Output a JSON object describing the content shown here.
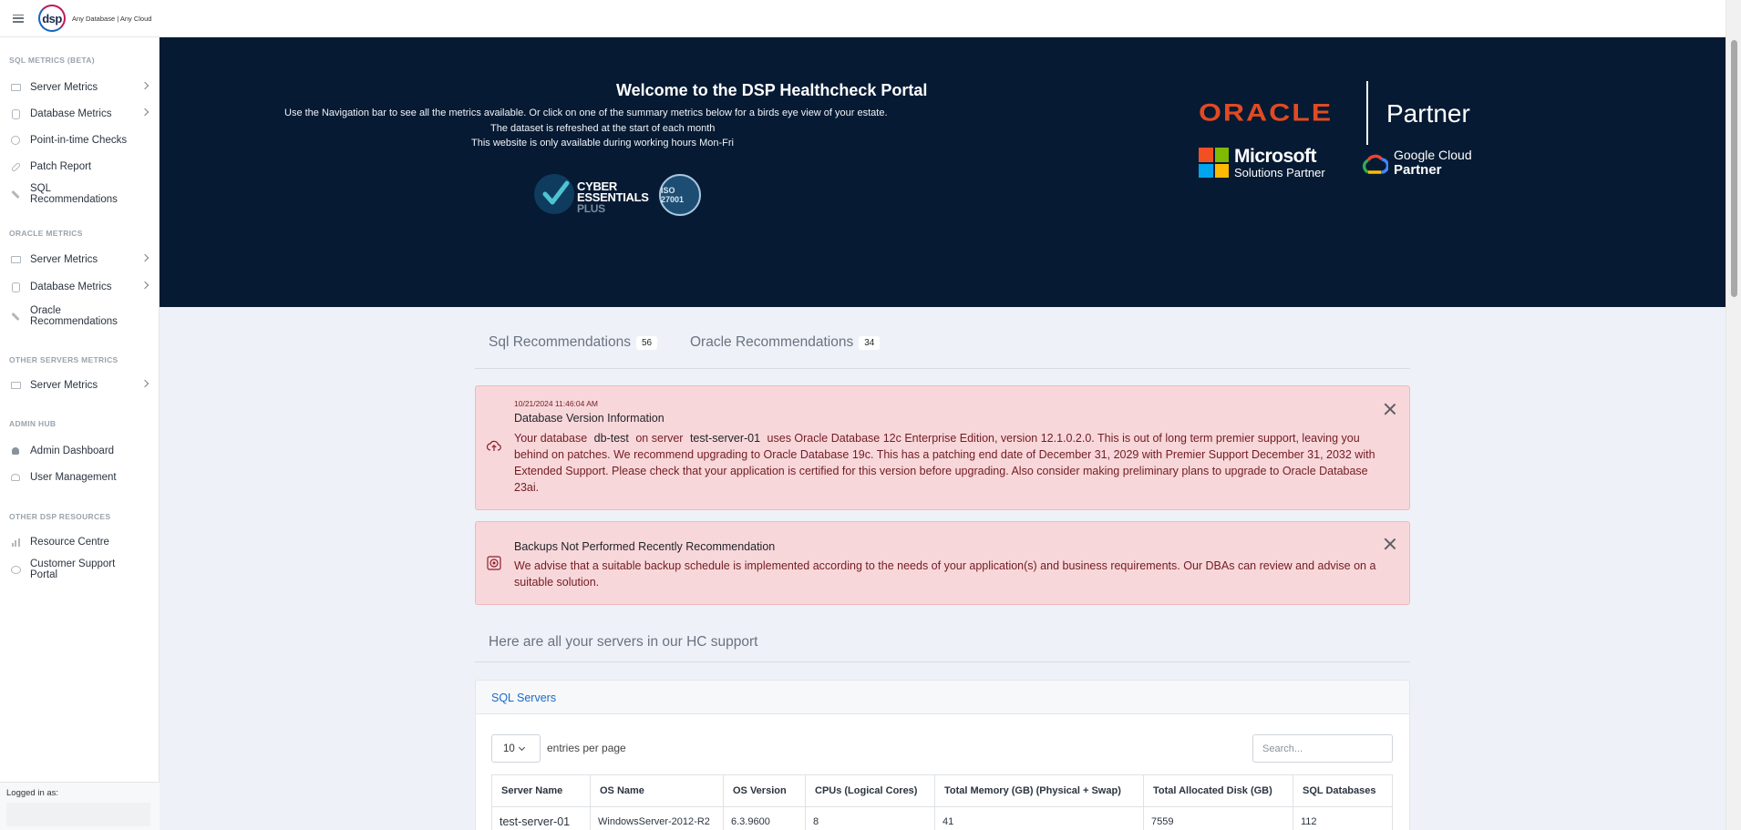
{
  "app": {
    "tagline": "Any Database | Any Cloud",
    "logo_text": "dsp"
  },
  "sidebar": {
    "sections": [
      {
        "title": "SQL METRICS (BETA)",
        "items": [
          {
            "label": "Server Metrics",
            "icon": "server-icon",
            "chevron": true
          },
          {
            "label": "Database Metrics",
            "icon": "database-icon",
            "chevron": true
          },
          {
            "label": "Point-in-time Checks",
            "icon": "clock-icon",
            "chevron": false
          },
          {
            "label": "Patch Report",
            "icon": "link-icon",
            "chevron": false
          },
          {
            "label": "SQL Recommendations",
            "icon": "wrench-icon",
            "chevron": false
          }
        ]
      },
      {
        "title": "ORACLE METRICS",
        "items": [
          {
            "label": "Server Metrics",
            "icon": "server-icon",
            "chevron": true
          },
          {
            "label": "Database Metrics",
            "icon": "database-icon",
            "chevron": true
          },
          {
            "label": "Oracle Recommendations",
            "icon": "wrench-icon",
            "chevron": false
          }
        ]
      },
      {
        "title": "OTHER SERVERS METRICS",
        "items": [
          {
            "label": "Server Metrics",
            "icon": "server-icon",
            "chevron": true
          }
        ]
      },
      {
        "title": "ADMIN HUB",
        "items": [
          {
            "label": "Admin Dashboard",
            "icon": "user-icon",
            "chevron": false
          },
          {
            "label": "User Management",
            "icon": "users-icon",
            "chevron": false
          }
        ]
      },
      {
        "title": "OTHER DSP RESOURCES",
        "items": [
          {
            "label": "Resource Centre",
            "icon": "bar-chart-icon",
            "chevron": false
          },
          {
            "label": "Customer Support Portal",
            "icon": "chat-icon",
            "chevron": false
          }
        ]
      }
    ],
    "logged_in_label": "Logged in as:"
  },
  "hero": {
    "title": "Welcome to the DSP Healthcheck Portal",
    "lines": [
      "Use the Navigation bar to see all the metrics available. Or click on one of the summary metrics below for a birds eye view of your estate.",
      "The dataset is refreshed at the start of each month",
      "This website is only available during working hours Mon-Fri"
    ],
    "cyber": {
      "line1": "CYBER",
      "line2": "ESSENTIALS",
      "line3": "PLUS"
    },
    "iso": "ISO 27001",
    "oracle": "ORACLE",
    "partner": "Partner",
    "microsoft": {
      "name": "Microsoft",
      "sub": "Solutions Partner"
    },
    "google": {
      "name": "Google Cloud",
      "sub": "Partner"
    },
    "colors": {
      "background": "#061a33",
      "oracle": "#e14a22"
    }
  },
  "tabs": [
    {
      "label": "Sql Recommendations",
      "count": "56"
    },
    {
      "label": "Oracle Recommendations",
      "count": "34"
    }
  ],
  "alerts": [
    {
      "timestamp": "10/21/2024 11:46:04 AM",
      "title": "Database Version Information",
      "icon": "cloud-upload-icon",
      "pre": "Your database",
      "db": "db-test",
      "mid": "on server",
      "server": "test-server-01",
      "text": "uses Oracle Database 12c Enterprise Edition, version 12.1.0.2.0. This is out of long term premier support, leaving you behind on patches. We recommend upgrading to Oracle Database 19c. This has a patching end date of December 31, 2029 with Premier Support December 31, 2032 with Extended Support. Please check that your application is certified for this version before upgrading. Also consider making preliminary plans to upgrade to Oracle Database 23ai."
    },
    {
      "title": "Backups Not Performed Recently Recommendation",
      "icon": "target-icon",
      "text": "We advise that a suitable backup schedule is implemented according to the needs of your application(s) and business requirements. Our DBAs can review and advise on a suitable solution."
    }
  ],
  "servers": {
    "heading": "Here are all your servers in our HC support",
    "card_title": "SQL Servers",
    "entries_value": "10",
    "entries_label": "entries per page",
    "search_placeholder": "Search...",
    "columns": [
      "Server Name",
      "OS Name",
      "OS Version",
      "CPUs (Logical Cores)",
      "Total Memory (GB) (Physical + Swap)",
      "Total Allocated Disk (GB)",
      "SQL Databases"
    ],
    "rows": [
      [
        "test-server-01",
        "WindowsServer-2012-R2",
        "6.3.9600",
        "8",
        "41",
        "7559",
        "112"
      ]
    ]
  }
}
